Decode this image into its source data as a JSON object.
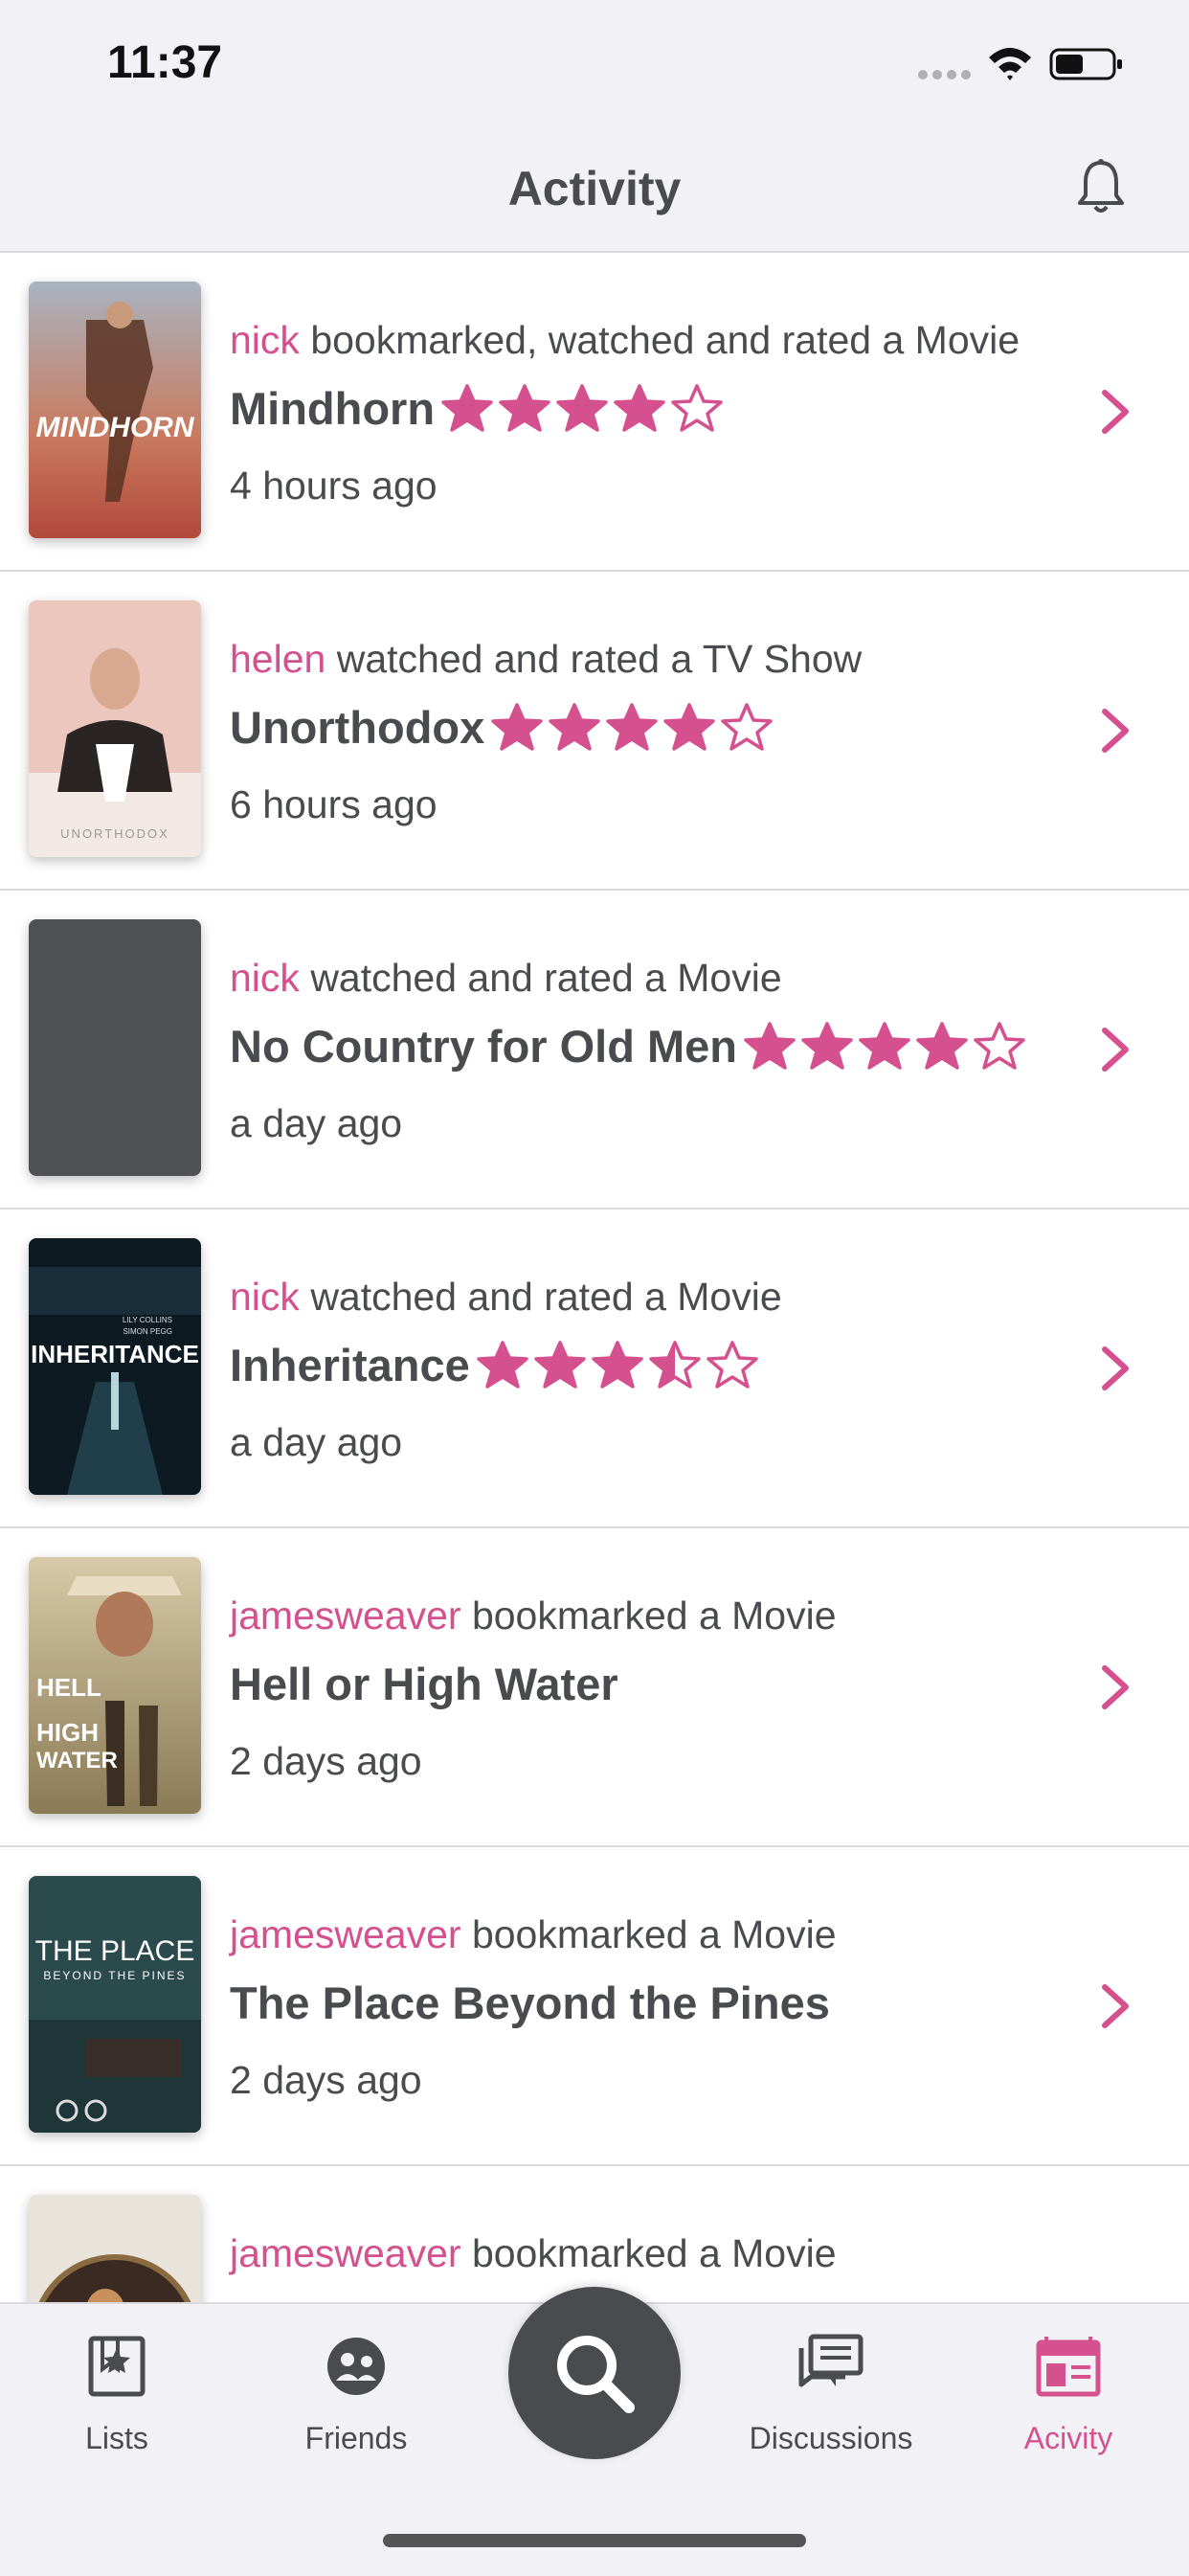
{
  "status_bar": {
    "time": "11:37"
  },
  "header": {
    "title": "Activity"
  },
  "colors": {
    "accent": "#d4508e",
    "text": "#4a4b4f",
    "bar_bg": "#f2f2f6"
  },
  "feed": [
    {
      "user": "nick",
      "action": "bookmarked, watched and rated a Movie",
      "title": "Mindhorn",
      "rating": 4,
      "time": "4 hours ago",
      "poster": "mindhorn-poster"
    },
    {
      "user": "helen",
      "action": "watched and rated a TV Show",
      "title": "Unorthodox",
      "rating": 4,
      "time": "6 hours ago",
      "poster": "unorthodox-poster",
      "poster_text": "UNORTHODOX"
    },
    {
      "user": "nick",
      "action": "watched and rated a Movie",
      "title": "No Country for Old Men",
      "rating": 4,
      "time": "a day ago",
      "poster": "placeholder-poster"
    },
    {
      "user": "nick",
      "action": "watched and rated a Movie",
      "title": "Inheritance",
      "rating": 3.5,
      "time": "a day ago",
      "poster": "inheritance-poster",
      "poster_text": "INHERITANCE",
      "poster_credits": "LILY COLLINS\nSIMON PEGG"
    },
    {
      "user": "jamesweaver",
      "action": "bookmarked a Movie",
      "title": "Hell or High Water",
      "rating": null,
      "time": "2 days ago",
      "poster": "hell-or-high-water-poster",
      "poster_text": "HELL OR HIGH WATER"
    },
    {
      "user": "jamesweaver",
      "action": "bookmarked a Movie",
      "title": "The Place Beyond the Pines",
      "rating": null,
      "time": "2 days ago",
      "poster": "place-beyond-pines-poster",
      "poster_text": "THE PLACE",
      "poster_subtext": "BEYOND THE PINES"
    },
    {
      "user": "jamesweaver",
      "action": "bookmarked a Movie",
      "title": "",
      "rating": null,
      "time": "",
      "poster": "partial-poster"
    }
  ],
  "tabs": [
    {
      "label": "Lists",
      "icon": "lists-icon",
      "active": false
    },
    {
      "label": "Friends",
      "icon": "friends-icon",
      "active": false
    },
    {
      "label": "Discussions",
      "icon": "discussions-icon",
      "active": false
    },
    {
      "label": "Acivity",
      "icon": "activity-icon",
      "active": true
    }
  ],
  "search_fab": {
    "icon": "search-icon"
  }
}
